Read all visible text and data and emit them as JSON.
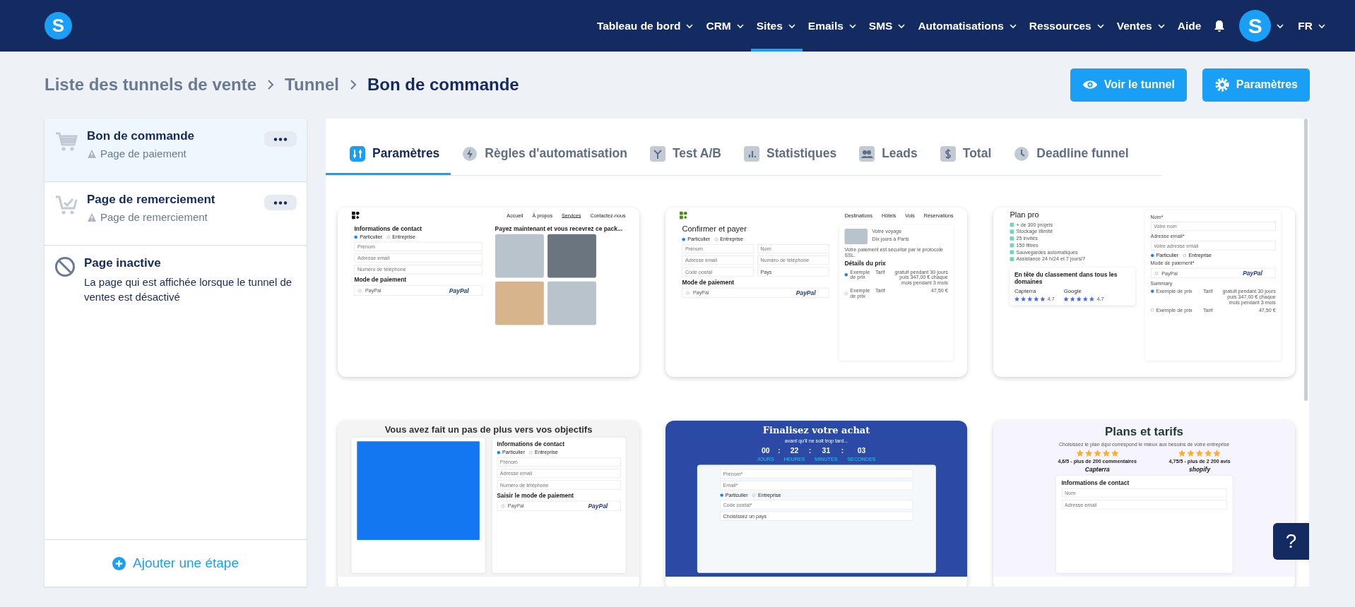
{
  "nav": {
    "logo": "S",
    "items": [
      {
        "label": "Tableau de bord",
        "selected": false,
        "dropdown": true
      },
      {
        "label": "CRM",
        "selected": false,
        "dropdown": true
      },
      {
        "label": "Sites",
        "selected": true,
        "dropdown": true
      },
      {
        "label": "Emails",
        "selected": false,
        "dropdown": true
      },
      {
        "label": "SMS",
        "selected": false,
        "dropdown": true
      },
      {
        "label": "Automatisations",
        "selected": false,
        "dropdown": true
      },
      {
        "label": "Ressources",
        "selected": false,
        "dropdown": true
      },
      {
        "label": "Ventes",
        "selected": false,
        "dropdown": true
      },
      {
        "label": "Aide",
        "selected": false,
        "dropdown": false
      }
    ],
    "avatar": "S",
    "language": "FR"
  },
  "breadcrumb": [
    "Liste des tunnels de vente",
    "Tunnel",
    "Bon de commande"
  ],
  "actions": [
    {
      "kind": "view",
      "label": "Voir le tunnel"
    },
    {
      "kind": "settings",
      "label": "Paramètres"
    }
  ],
  "steps": [
    {
      "kind": "cart",
      "title": "Bon de commande",
      "subtitle": "Page de paiement",
      "selected": true
    },
    {
      "kind": "cart-check",
      "title": "Page de remerciement",
      "subtitle": "Page de remerciement",
      "selected": false
    },
    {
      "kind": "inactive",
      "title": "Page inactive",
      "description": "La page qui est affichée lorsque le tunnel de ventes est désactivé",
      "selected": false
    }
  ],
  "add_step": "Ajouter une étape",
  "tabs": [
    {
      "kind": "sliders",
      "label": "Paramètres",
      "selected": true
    },
    {
      "kind": "bolt",
      "label": "Règles d'automatisation",
      "selected": false
    },
    {
      "kind": "split",
      "label": "Test A/B",
      "selected": false
    },
    {
      "kind": "chart",
      "label": "Statistiques",
      "selected": false
    },
    {
      "kind": "people",
      "label": "Leads",
      "selected": false
    },
    {
      "kind": "dollar",
      "label": "Total",
      "selected": false
    },
    {
      "kind": "clock",
      "label": "Deadline funnel",
      "selected": false
    }
  ],
  "templates": [
    {
      "kind": "light",
      "nav": {
        "links": [
          {
            "label": "Accueil",
            "selected": false
          },
          {
            "label": "À propos",
            "selected": false
          },
          {
            "label": "Services",
            "selected": true
          },
          {
            "label": "Contactez-nous",
            "selected": false
          }
        ]
      },
      "columns": [
        {
          "kind": "plain",
          "blocks": [
            {
              "kind": "heading",
              "text": "Informations de contact"
            },
            {
              "kind": "radios",
              "options": [
                {
                  "label": "Particulier",
                  "selected": true
                },
                {
                  "label": "Entreprise",
                  "selected": false
                }
              ]
            },
            {
              "kind": "field",
              "placeholder": "Prénom"
            },
            {
              "kind": "field",
              "placeholder": "Adresse email"
            },
            {
              "kind": "field",
              "placeholder": "Numéro de téléphone"
            },
            {
              "kind": "heading",
              "text": "Mode de paiement"
            },
            {
              "kind": "paypal",
              "label": "PayPal",
              "logo": "PayPal"
            }
          ]
        },
        {
          "kind": "plain",
          "blocks": [
            {
              "kind": "heading",
              "text": "Payez maintenant et vous recevrez ce pack..."
            },
            {
              "kind": "photo-grid"
            }
          ]
        }
      ]
    },
    {
      "kind": "light",
      "nav": {
        "links": [
          {
            "label": "Destinations",
            "selected": false
          },
          {
            "label": "Hôtels",
            "selected": false
          },
          {
            "label": "Vols",
            "selected": false
          },
          {
            "label": "Réservations",
            "selected": false
          }
        ]
      },
      "columns": [
        {
          "kind": "plain",
          "blocks": [
            {
              "kind": "title",
              "text": "Confirmer et payer"
            },
            {
              "kind": "radios",
              "options": [
                {
                  "label": "Particulier",
                  "selected": true
                },
                {
                  "label": "Entreprise",
                  "selected": false
                }
              ]
            },
            {
              "kind": "fields",
              "placeholders": [
                "Prénom",
                "Nom"
              ]
            },
            {
              "kind": "fields",
              "placeholders": [
                "Adresse email",
                "Numéro de téléphone"
              ]
            },
            {
              "kind": "field-select",
              "placeholder": "Code postal",
              "value": "Pays"
            },
            {
              "kind": "heading",
              "text": "Mode de paiement"
            },
            {
              "kind": "paypal",
              "label": "PayPal",
              "logo": "PayPal"
            }
          ]
        },
        {
          "kind": "panel",
          "blocks": [
            {
              "kind": "trip",
              "lines": [
                "Votre voyage",
                "Dix jours à Paris"
              ]
            },
            {
              "kind": "text",
              "text": "Votre paiement est sécurisé par le protocole SSL."
            },
            {
              "kind": "heading",
              "text": "Détails du prix"
            },
            {
              "kind": "price",
              "label": "Exemple de prix",
              "column": "Tarif",
              "value": "gratuit pendant 30 jours puis 347,00 € chaque mois pendant 3 mois",
              "selected": true
            },
            {
              "kind": "price",
              "label": "Exemple de prix",
              "column": "Tarif",
              "value": "47,50 €",
              "selected": false
            }
          ]
        }
      ]
    },
    {
      "kind": "light",
      "columns": [
        {
          "kind": "plain",
          "blocks": [
            {
              "kind": "title",
              "text": "Plan pro"
            },
            {
              "kind": "checklist",
              "items": [
                "+ de 300 projets",
                "Stockage illimité",
                "25 invités",
                "150 filtres",
                "Sauvegardes automatiques",
                "Assistance 24 h/24 et 7 jours/7"
              ]
            },
            {
              "kind": "card",
              "blocks": [
                {
                  "kind": "heading",
                  "text": "En tête du classement dans tous les domaines"
                },
                {
                  "kind": "ratings",
                  "items": [
                    {
                      "name": "Capterra",
                      "stars": 5,
                      "score": "4.7"
                    },
                    {
                      "name": "Google",
                      "stars": 5,
                      "score": "4.7"
                    }
                  ]
                }
              ]
            }
          ]
        },
        {
          "kind": "panel",
          "blocks": [
            {
              "kind": "label",
              "text": "Nom*"
            },
            {
              "kind": "field",
              "placeholder": "Votre nom"
            },
            {
              "kind": "label",
              "text": "Adresse email*"
            },
            {
              "kind": "field",
              "placeholder": "Votre adresse email"
            },
            {
              "kind": "radios",
              "options": [
                {
                  "label": "Particulier",
                  "selected": true
                },
                {
                  "label": "Entreprise",
                  "selected": false
                }
              ]
            },
            {
              "kind": "label",
              "text": "Mode de paiement*"
            },
            {
              "kind": "paypal",
              "label": "PayPal",
              "logo": "PayPal"
            },
            {
              "kind": "label",
              "text": "Summary"
            },
            {
              "kind": "price",
              "label": "Exemple de prix",
              "column": "Tarif",
              "value": "gratuit pendant 30 jours puis 347,00 € chaque mois pendant 3 mois",
              "selected": true
            },
            {
              "kind": "price",
              "label": "Exemple de prix",
              "column": "Tarif",
              "value": "47,50 €",
              "selected": false
            }
          ]
        }
      ]
    },
    {
      "kind": "grey",
      "title": "Vous avez fait un pas de plus vers vos objectifs",
      "columns": [
        {
          "kind": "panel",
          "blocks": [
            {
              "kind": "photo"
            }
          ]
        },
        {
          "kind": "panel",
          "blocks": [
            {
              "kind": "heading",
              "text": "Informations de contact"
            },
            {
              "kind": "radios",
              "options": [
                {
                  "label": "Particulier",
                  "selected": true
                },
                {
                  "label": "Entreprise",
                  "selected": false
                }
              ]
            },
            {
              "kind": "field",
              "placeholder": "Prénom"
            },
            {
              "kind": "field",
              "placeholder": "Adresse email"
            },
            {
              "kind": "field",
              "placeholder": "Numéro de téléphone"
            },
            {
              "kind": "heading",
              "text": "Saisir le mode de paiement"
            },
            {
              "kind": "paypal",
              "label": "PayPal",
              "logo": "PayPal"
            }
          ]
        }
      ]
    },
    {
      "kind": "blue",
      "title": "Finalisez votre achat",
      "subtitle": "avant qu'il ne soit trop tard...",
      "countdown": {
        "separator": ":",
        "units": [
          {
            "value": "00",
            "label": "JOURS"
          },
          {
            "value": "22",
            "label": "HEURES"
          },
          {
            "value": "31",
            "label": "MINUTES"
          },
          {
            "value": "03",
            "label": "SECONDES"
          }
        ]
      },
      "columns": [
        {
          "kind": "panel",
          "blocks": [
            {
              "kind": "field",
              "placeholder": "Prénom*"
            },
            {
              "kind": "field",
              "placeholder": "Email*"
            },
            {
              "kind": "radios",
              "options": [
                {
                  "label": "Particulier",
                  "selected": true
                },
                {
                  "label": "Entreprise",
                  "selected": false
                }
              ]
            },
            {
              "kind": "field",
              "placeholder": "Code postal*"
            },
            {
              "kind": "select",
              "value": "Choisissez un pays"
            }
          ]
        }
      ]
    },
    {
      "kind": "lavender",
      "title": "Plans et tarifs",
      "subtitle": "Choisissez le plan dqui correspond le mieux aux besoins de votre entreprise",
      "reviews": [
        {
          "stars": 5,
          "text": "4,6/5 - plus de 200 commentaires",
          "brand": "Capterra"
        },
        {
          "stars": 5,
          "text": "4,75/5 - plus de 2 200 avis",
          "brand": "shopify"
        }
      ],
      "columns": [
        {
          "kind": "panel",
          "blocks": [
            {
              "kind": "heading",
              "text": "Informations de contact"
            },
            {
              "kind": "field",
              "placeholder": "Nom"
            },
            {
              "kind": "field",
              "placeholder": "Adresse email"
            }
          ]
        }
      ]
    }
  ],
  "help": "?"
}
